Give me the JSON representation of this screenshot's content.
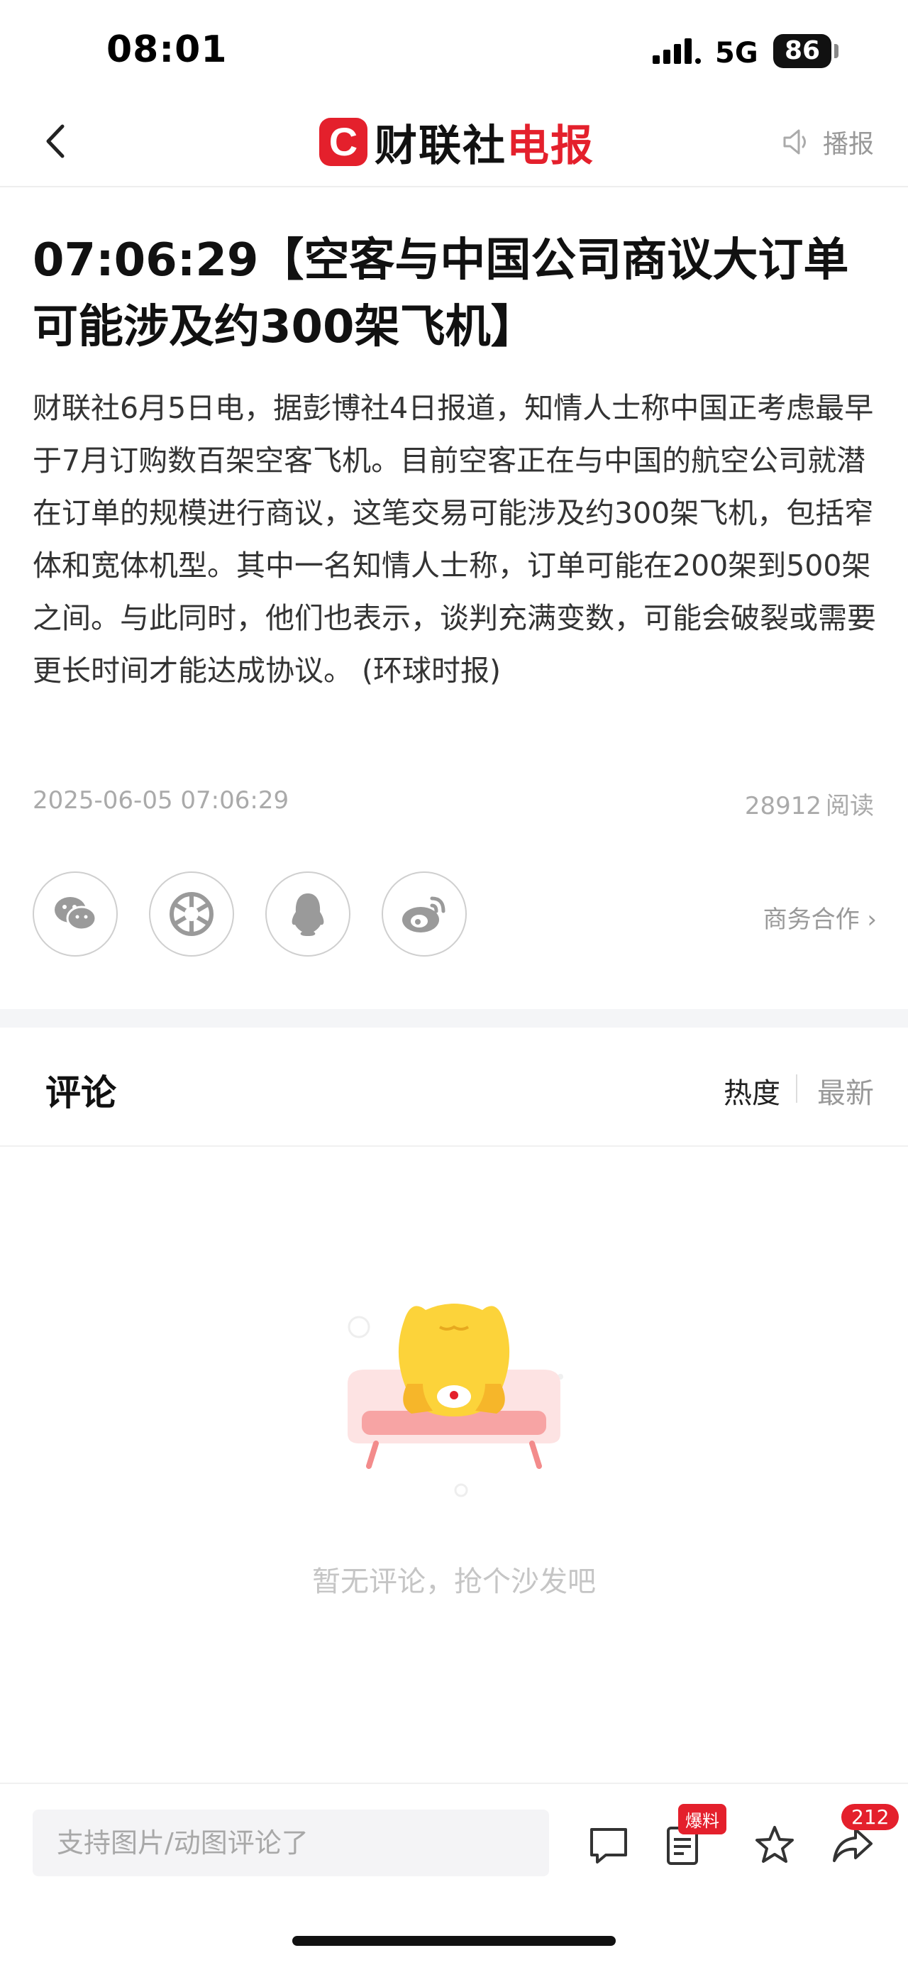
{
  "status_bar": {
    "time": "08:01",
    "network": "5G",
    "battery": "86"
  },
  "nav": {
    "logo_mark": "C",
    "logo_text_black": "财联社",
    "logo_text_red": "电报",
    "broadcast_label": "播报"
  },
  "article": {
    "title": "07:06:29【空客与中国公司商议大订单可能涉及约300架飞机】",
    "body": "财联社6月5日电，据彭博社4日报道，知情人士称中国正考虑最早于7月订购数百架空客飞机。目前空客正在与中国的航空公司就潜在订单的规模进行商议，这笔交易可能涉及约300架飞机，包括窄体和宽体机型。其中一名知情人士称，订单可能在200架到500架之间。与此同时，他们也表示，谈判充满变数，可能会破裂或需要更长时间才能达成协议。 (环球时报)",
    "datetime": "2025-06-05 07:06:29",
    "read_count": "28912",
    "read_label": "阅读"
  },
  "share": {
    "business_label": "商务合作 ›",
    "icons": [
      "wechat-icon",
      "moments-icon",
      "qq-icon",
      "weibo-icon"
    ]
  },
  "comments": {
    "title": "评论",
    "sort_hot": "热度",
    "sort_new": "最新",
    "empty_text": "暂无评论，抢个沙发吧"
  },
  "bottom_bar": {
    "input_placeholder": "支持图片/动图评论了",
    "baoliao_badge": "爆料",
    "share_count": "212"
  },
  "colors": {
    "brand_red": "#e4202c",
    "muted": "#999999"
  }
}
